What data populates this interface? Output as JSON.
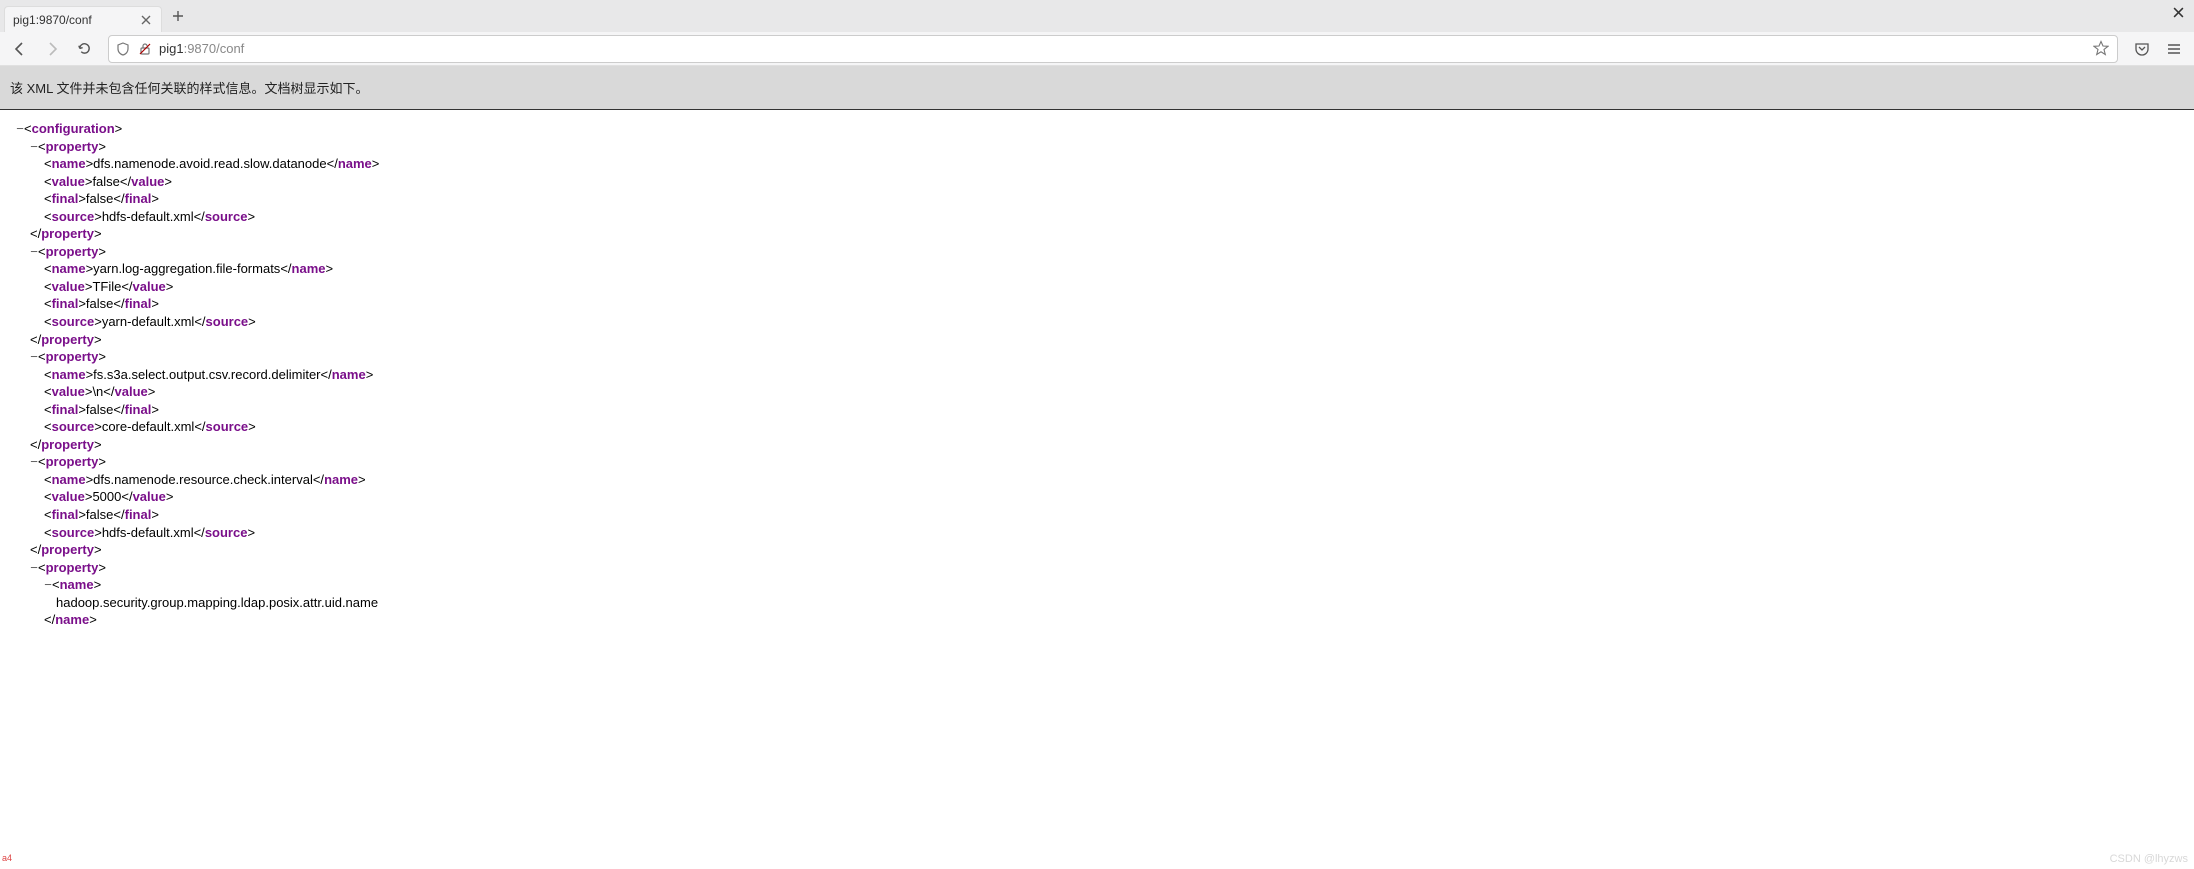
{
  "browser": {
    "tab_title": "pig1:9870/conf",
    "url_display_host": "pig1",
    "url_display_path": ":9870/conf"
  },
  "banner": {
    "message": "该 XML 文件并未包含任何关联的样式信息。文档树显示如下。"
  },
  "xml": {
    "root_tag": "configuration",
    "properties": [
      {
        "name": "dfs.namenode.avoid.read.slow.datanode",
        "value": "false",
        "final": "false",
        "source": "hdfs-default.xml"
      },
      {
        "name": "yarn.log-aggregation.file-formats",
        "value": "TFile",
        "final": "false",
        "source": "yarn-default.xml"
      },
      {
        "name": "fs.s3a.select.output.csv.record.delimiter",
        "value": "\\n",
        "final": "false",
        "source": "core-default.xml"
      },
      {
        "name": "dfs.namenode.resource.check.interval",
        "value": "5000",
        "final": "false",
        "source": "hdfs-default.xml"
      }
    ],
    "partial_property": {
      "name": "hadoop.security.group.mapping.ldap.posix.attr.uid.name"
    }
  },
  "watermark": "CSDN @lhyzws",
  "red_marker": "a4"
}
